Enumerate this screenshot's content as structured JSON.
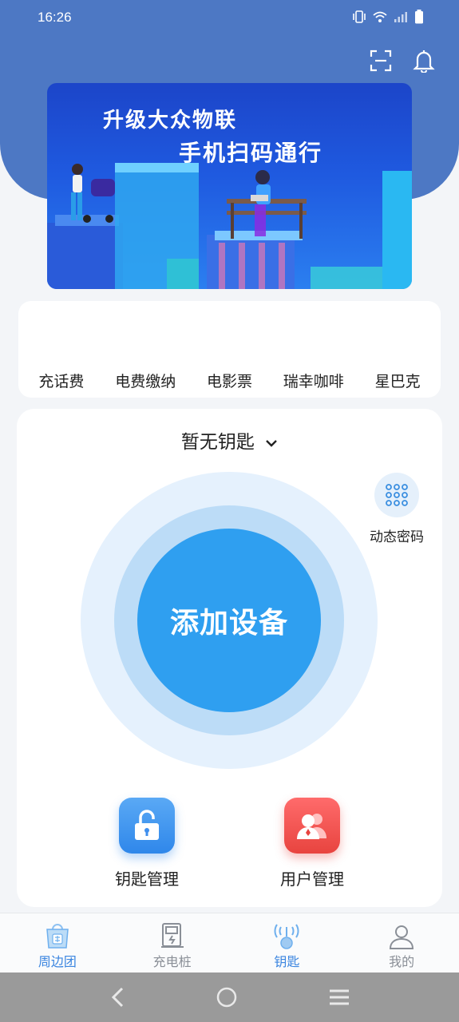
{
  "status_bar": {
    "time": "16:26"
  },
  "banner": {
    "line1": "升级大众物联",
    "line2": "手机扫码通行"
  },
  "services": [
    "充话费",
    "电费缴纳",
    "电影票",
    "瑞幸咖啡",
    "星巴克"
  ],
  "main": {
    "key_selector": "暂无钥匙",
    "dynamic_password": "动态密码",
    "add_device": "添加设备",
    "key_management": "钥匙管理",
    "user_management": "用户管理"
  },
  "tabs": [
    {
      "label": "周边团",
      "icon": "group-buy-icon",
      "active": true
    },
    {
      "label": "充电桩",
      "icon": "charging-pile-icon",
      "active": false
    },
    {
      "label": "钥匙",
      "icon": "key-signal-icon",
      "active": false
    },
    {
      "label": "我的",
      "icon": "profile-icon",
      "active": false
    }
  ],
  "colors": {
    "header": "#4d78c4",
    "accent": "#2f9ff0",
    "tab_active": "#3c86e0",
    "user_tile": "#e8443f"
  }
}
